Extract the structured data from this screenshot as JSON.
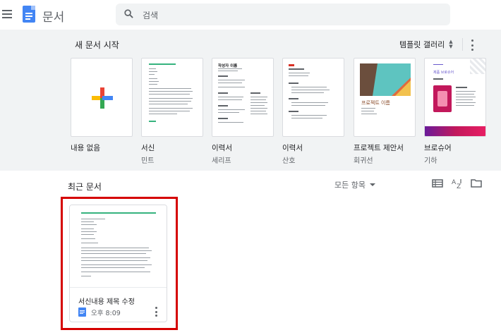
{
  "header": {
    "app_title": "문서",
    "search_placeholder": "검색"
  },
  "gallery": {
    "title": "새 문서 시작",
    "gallery_link": "템플릿 갤러리",
    "templates": [
      {
        "name": "내용 없음",
        "sub": ""
      },
      {
        "name": "서신",
        "sub": "민트"
      },
      {
        "name": "이력서",
        "sub": "세리프"
      },
      {
        "name": "이력서",
        "sub": "산호"
      },
      {
        "name": "프로젝트 제안서",
        "sub": "회귀선"
      },
      {
        "name": "브로슈어",
        "sub": "기하"
      }
    ],
    "thumb_text": {
      "resume_serif_name": "작성자 이름",
      "project_name": "프로젝트 이름",
      "brochure_heading": "제품 브로슈어"
    }
  },
  "recent": {
    "title": "최근 문서",
    "owner_filter": "모든 항목",
    "docs": [
      {
        "title": "서신내용 제목 수정",
        "time": "오후 8:09"
      }
    ]
  },
  "colors": {
    "mint": "#36b37e",
    "brand_blue": "#4285f4",
    "highlight": "#d50000"
  }
}
